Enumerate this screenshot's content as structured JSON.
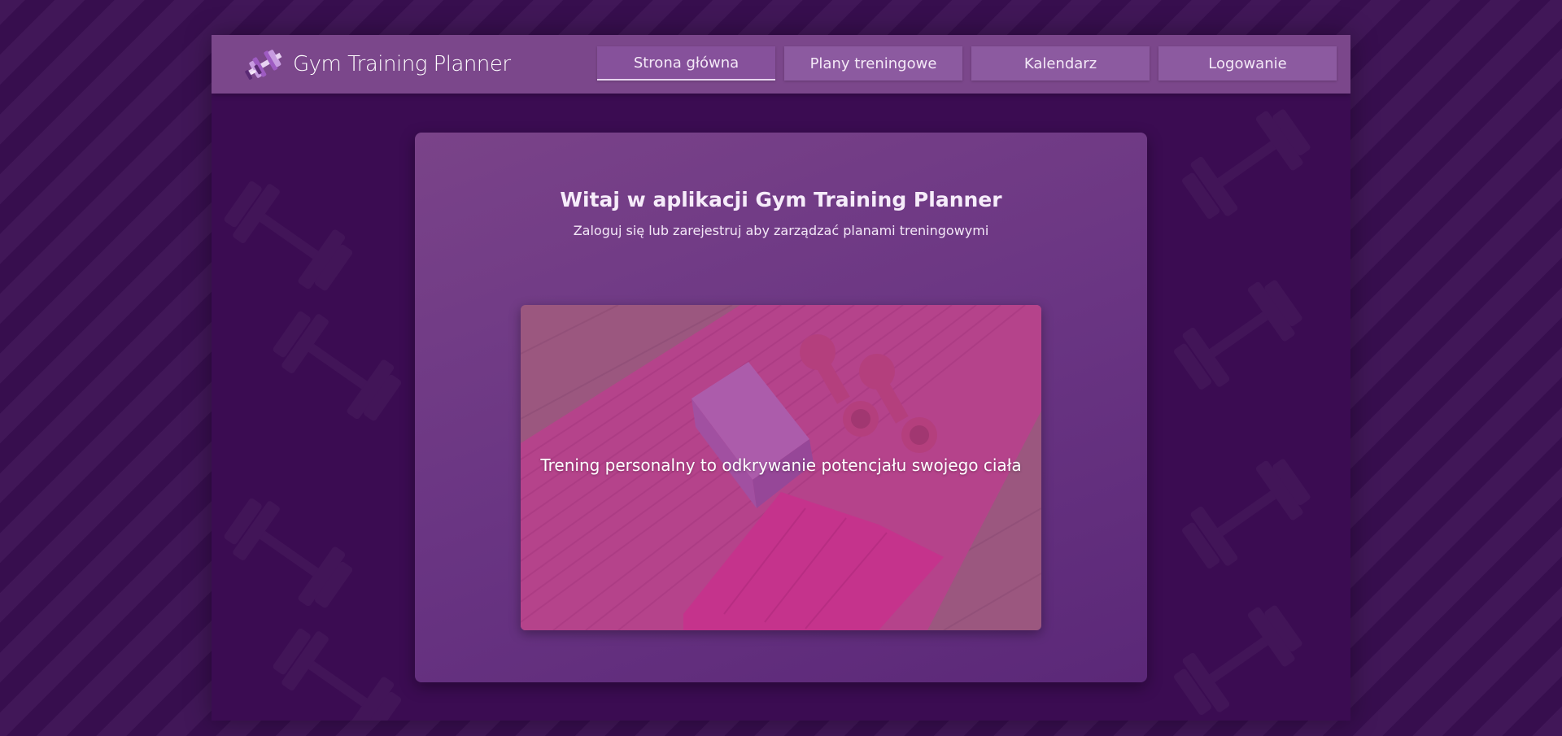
{
  "app": {
    "title": "Gym Training Planner",
    "logo_icon": "dumbbell-icon"
  },
  "nav": {
    "items": [
      {
        "label": "Strona główna",
        "active": true
      },
      {
        "label": "Plany treningowe",
        "active": false
      },
      {
        "label": "Kalendarz",
        "active": false
      },
      {
        "label": "Logowanie",
        "active": false
      }
    ]
  },
  "main": {
    "title": "Witaj w aplikacji Gym Training Planner",
    "subtitle": "Zaloguj się lub zarejestruj aby zarządzać planami treningowymi",
    "hero": {
      "caption": "Trening personalny to odkrywanie potencjału swojego ciała",
      "image_subject": "yoga-mat-dumbbells-block-towel-image"
    }
  },
  "colors": {
    "page_background": "#3a0f52",
    "header": "#7b478b",
    "nav_button": "#8c5aa0",
    "card": "#6a3583",
    "text": "#ffffff"
  }
}
